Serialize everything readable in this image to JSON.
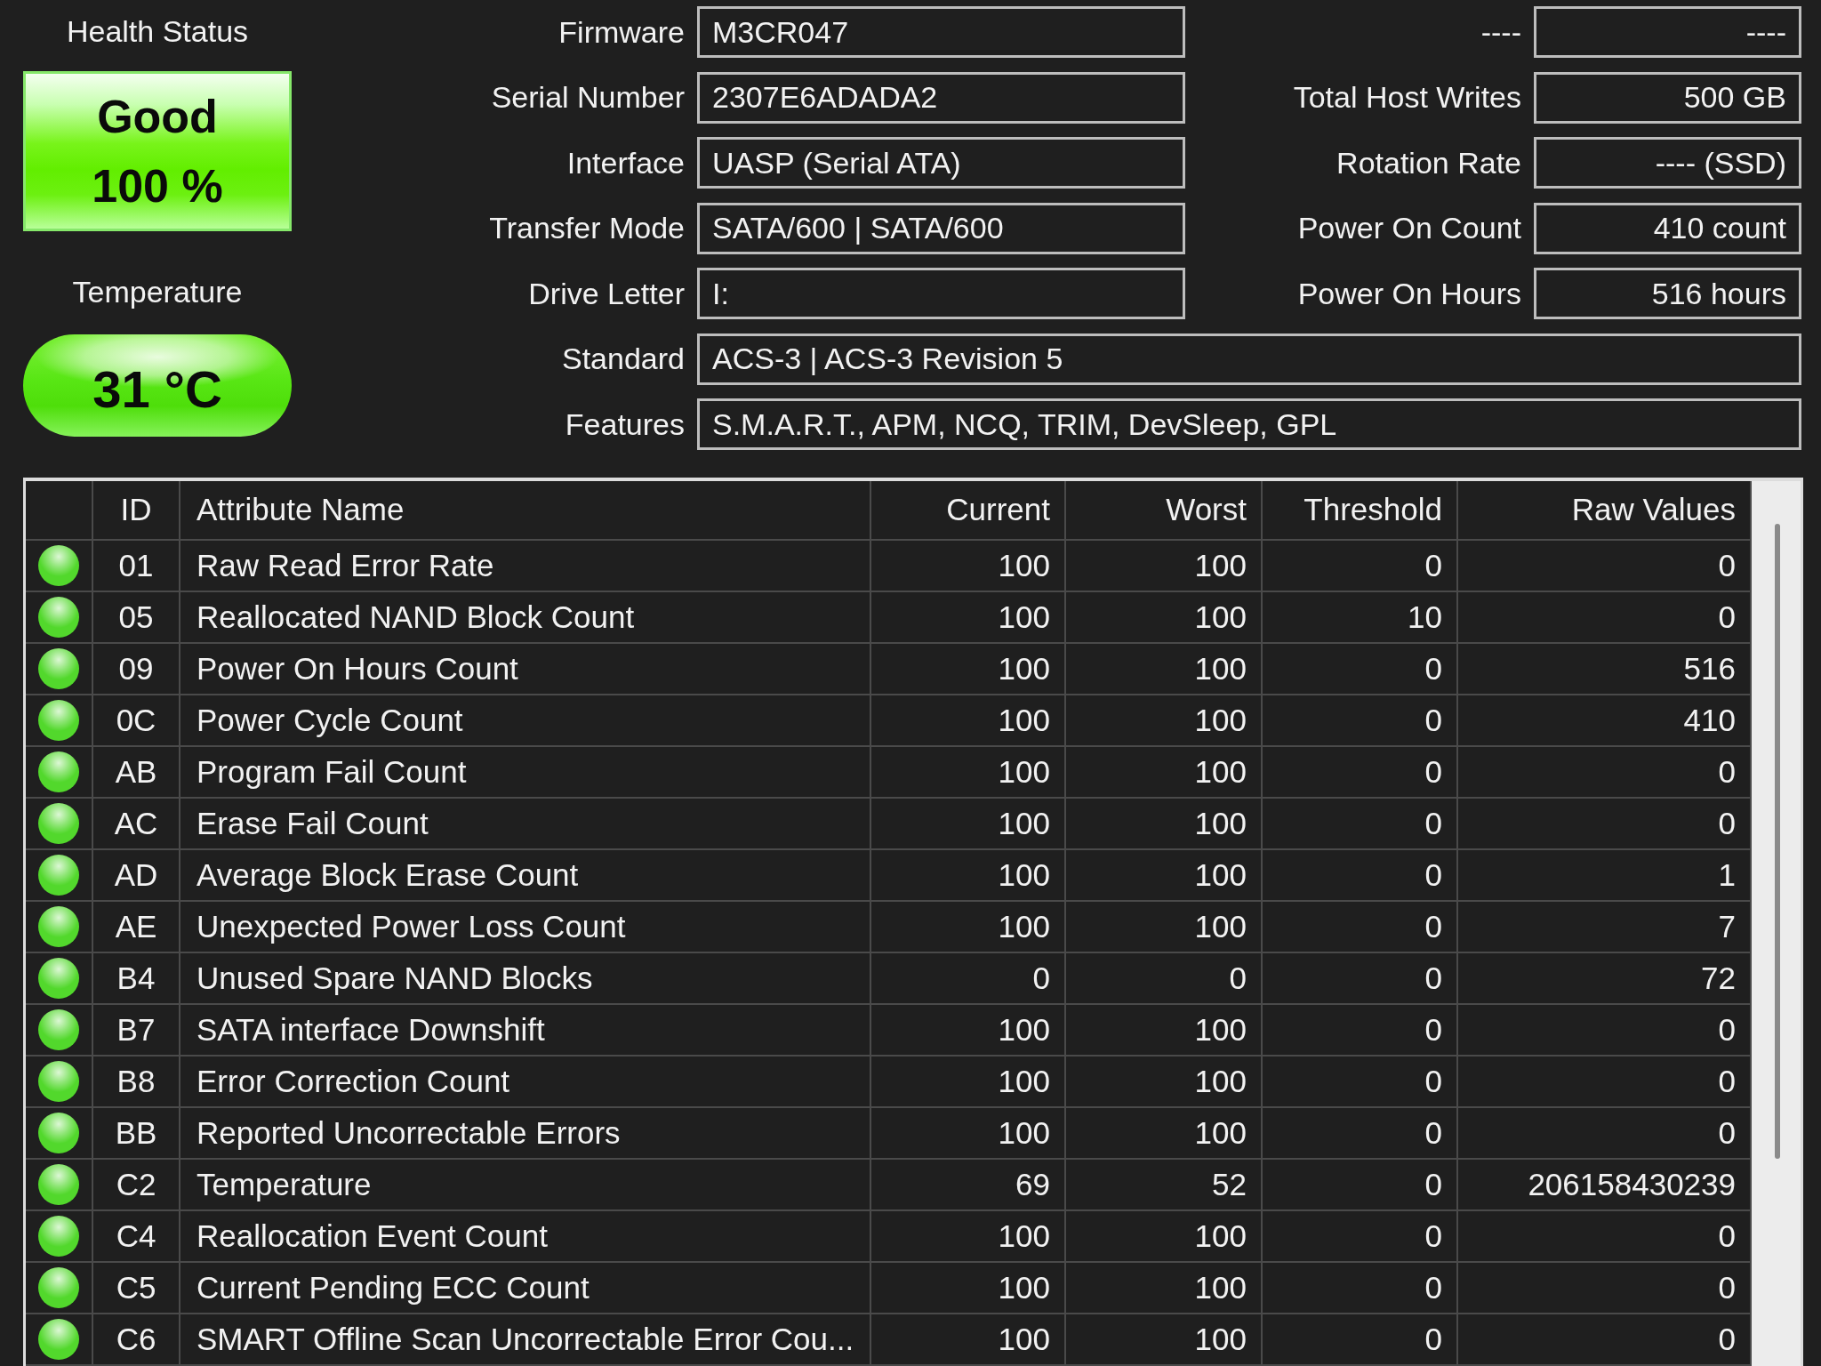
{
  "health": {
    "label": "Health Status",
    "status": "Good",
    "percent": "100 %"
  },
  "temperature": {
    "label": "Temperature",
    "value": "31 °C"
  },
  "info_left": [
    {
      "label": "Firmware",
      "value": "M3CR047"
    },
    {
      "label": "Serial Number",
      "value": "2307E6ADADA2"
    },
    {
      "label": "Interface",
      "value": "UASP (Serial ATA)"
    },
    {
      "label": "Transfer Mode",
      "value": "SATA/600 | SATA/600"
    },
    {
      "label": "Drive Letter",
      "value": "I:"
    }
  ],
  "info_right": [
    {
      "label": "----",
      "value": "----"
    },
    {
      "label": "Total Host Writes",
      "value": "500 GB"
    },
    {
      "label": "Rotation Rate",
      "value": "---- (SSD)"
    },
    {
      "label": "Power On Count",
      "value": "410 count"
    },
    {
      "label": "Power On Hours",
      "value": "516 hours"
    }
  ],
  "info_wide": [
    {
      "label": "Standard",
      "value": "ACS-3 | ACS-3 Revision 5"
    },
    {
      "label": "Features",
      "value": "S.M.A.R.T., APM, NCQ, TRIM, DevSleep, GPL"
    }
  ],
  "table": {
    "columns": [
      "ID",
      "Attribute Name",
      "Current",
      "Worst",
      "Threshold",
      "Raw Values"
    ],
    "rows": [
      {
        "color": "#52d82c",
        "cells": [
          "01",
          "Raw Read Error Rate",
          "100",
          "100",
          "0",
          "0"
        ]
      },
      {
        "color": "#52d82c",
        "cells": [
          "05",
          "Reallocated NAND Block Count",
          "100",
          "100",
          "10",
          "0"
        ]
      },
      {
        "color": "#52d82c",
        "cells": [
          "09",
          "Power On Hours Count",
          "100",
          "100",
          "0",
          "516"
        ]
      },
      {
        "color": "#52d82c",
        "cells": [
          "0C",
          "Power Cycle Count",
          "100",
          "100",
          "0",
          "410"
        ]
      },
      {
        "color": "#52d82c",
        "cells": [
          "AB",
          "Program Fail Count",
          "100",
          "100",
          "0",
          "0"
        ]
      },
      {
        "color": "#52d82c",
        "cells": [
          "AC",
          "Erase Fail Count",
          "100",
          "100",
          "0",
          "0"
        ]
      },
      {
        "color": "#52d82c",
        "cells": [
          "AD",
          "Average Block Erase Count",
          "100",
          "100",
          "0",
          "1"
        ]
      },
      {
        "color": "#52d82c",
        "cells": [
          "AE",
          "Unexpected Power Loss Count",
          "100",
          "100",
          "0",
          "7"
        ]
      },
      {
        "color": "#52d82c",
        "cells": [
          "B4",
          "Unused Spare NAND Blocks",
          "0",
          "0",
          "0",
          "72"
        ]
      },
      {
        "color": "#52d82c",
        "cells": [
          "B7",
          "SATA interface Downshift",
          "100",
          "100",
          "0",
          "0"
        ]
      },
      {
        "color": "#52d82c",
        "cells": [
          "B8",
          "Error Correction Count",
          "100",
          "100",
          "0",
          "0"
        ]
      },
      {
        "color": "#52d82c",
        "cells": [
          "BB",
          "Reported Uncorrectable Errors",
          "100",
          "100",
          "0",
          "0"
        ]
      },
      {
        "color": "#52d82c",
        "cells": [
          "C2",
          "Temperature",
          "69",
          "52",
          "0",
          "206158430239"
        ]
      },
      {
        "color": "#52d82c",
        "cells": [
          "C4",
          "Reallocation Event Count",
          "100",
          "100",
          "0",
          "0"
        ]
      },
      {
        "color": "#52d82c",
        "cells": [
          "C5",
          "Current Pending ECC Count",
          "100",
          "100",
          "0",
          "0"
        ]
      },
      {
        "color": "#52d82c",
        "cells": [
          "C6",
          "SMART Offline Scan Uncorrectable Error Cou...",
          "100",
          "100",
          "0",
          "0"
        ]
      }
    ]
  }
}
